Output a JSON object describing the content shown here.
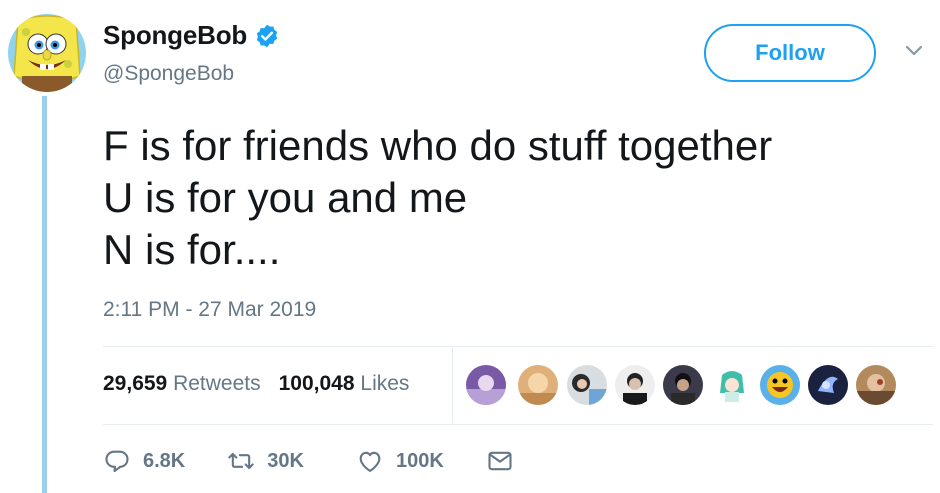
{
  "user": {
    "display_name": "SpongeBob",
    "handle": "@SpongeBob",
    "verified_icon": "verified-badge-icon"
  },
  "follow_button": {
    "label": "Follow"
  },
  "menu": {
    "icon": "chevron-down-icon"
  },
  "tweet": {
    "lines": [
      "F is for friends who do stuff together",
      "U is for you and me",
      "N is for...."
    ],
    "timestamp": "2:11 PM - 27 Mar 2019"
  },
  "stats": {
    "retweets_count": "29,659",
    "retweets_label": "Retweets",
    "likes_count": "100,048",
    "likes_label": "Likes"
  },
  "likers_count_shown": 9,
  "actions": {
    "reply_count": "6.8K",
    "retweet_count": "30K",
    "like_count": "100K",
    "reply_icon": "reply-icon",
    "retweet_icon": "retweet-icon",
    "like_icon": "heart-icon",
    "dm_icon": "envelope-icon"
  },
  "colors": {
    "accent": "#1da1f2",
    "secondary_text": "#657786",
    "thread_line": "#9ecfea"
  }
}
